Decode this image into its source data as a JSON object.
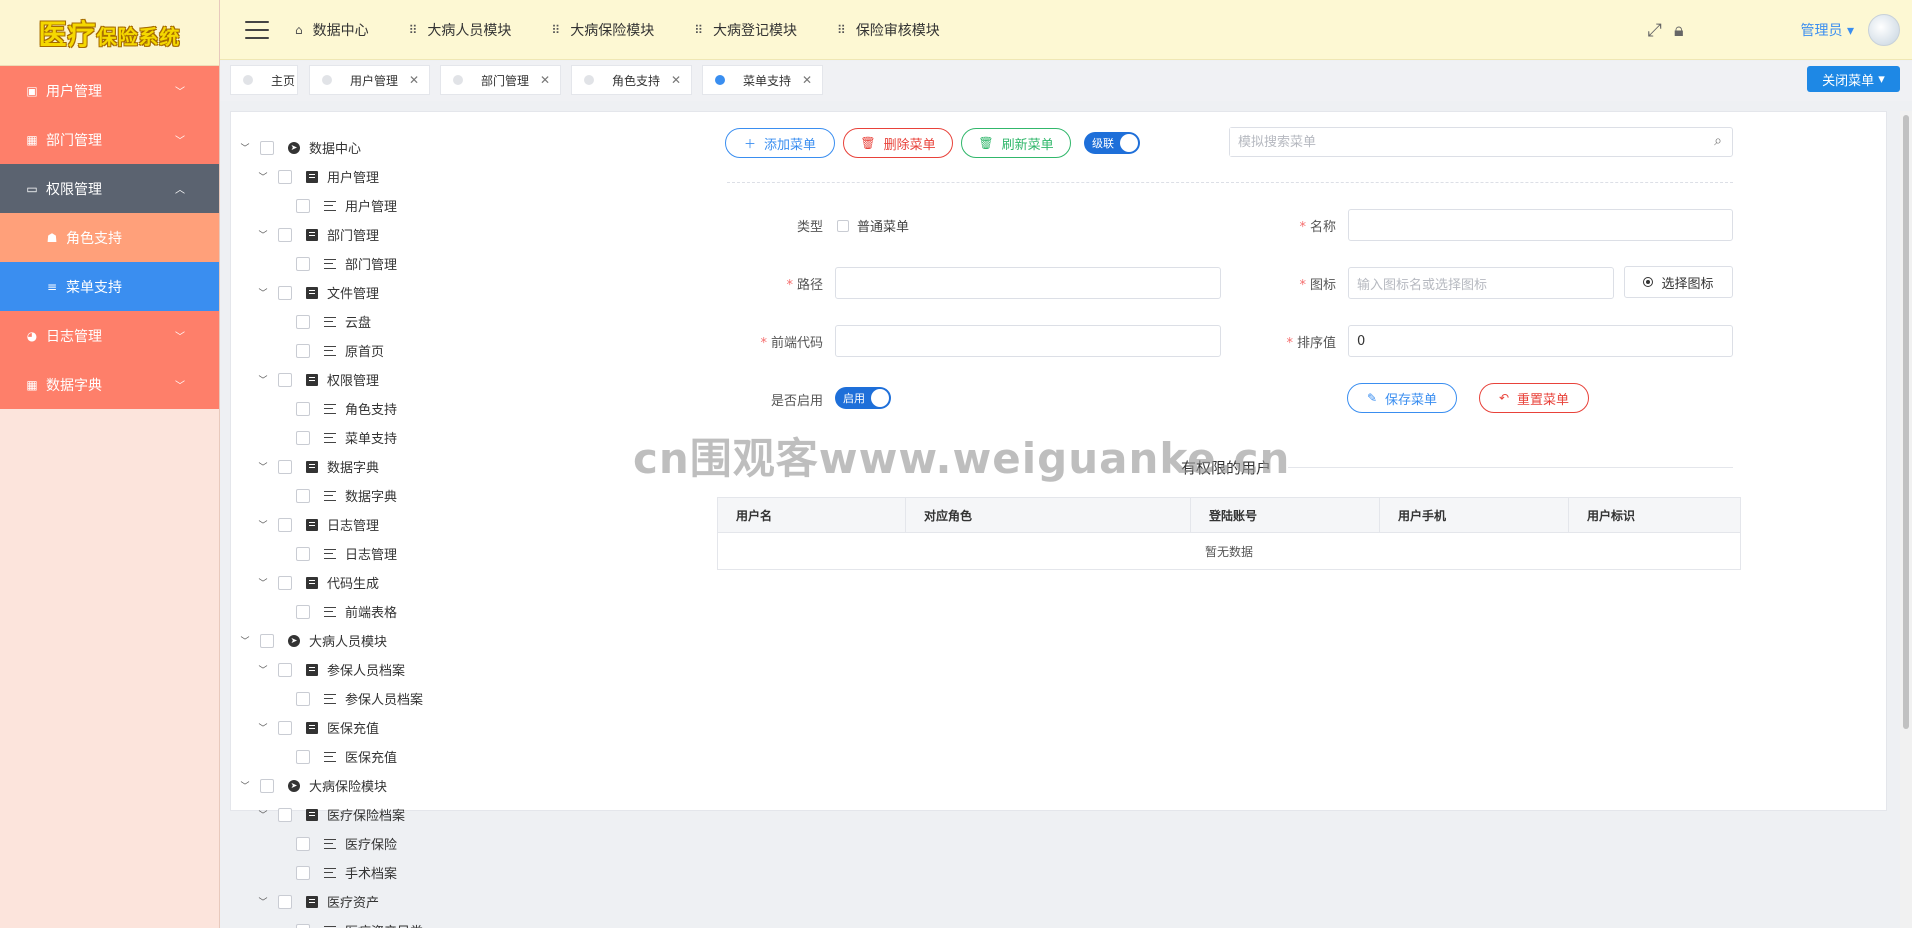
{
  "app": {
    "logo_main": "医疗",
    "logo_sub": "保险系统"
  },
  "sidebar": {
    "items": [
      {
        "label": "用户管理",
        "icon": "dashboard-icon"
      },
      {
        "label": "部门管理",
        "icon": "grid-icon"
      },
      {
        "label": "权限管理",
        "icon": "monitor-icon"
      },
      {
        "label": "角色支持",
        "icon": "users-icon"
      },
      {
        "label": "菜单支持",
        "icon": "list-icon"
      },
      {
        "label": "日志管理",
        "icon": "pie-icon"
      },
      {
        "label": "数据字典",
        "icon": "grid-icon"
      }
    ]
  },
  "header": {
    "nav": [
      {
        "label": "数据中心",
        "icon": "home-icon"
      },
      {
        "label": "大病人员模块",
        "icon": "apps-icon"
      },
      {
        "label": "大病保险模块",
        "icon": "apps-icon"
      },
      {
        "label": "大病登记模块",
        "icon": "apps-icon"
      },
      {
        "label": "保险审核模块",
        "icon": "apps-icon"
      }
    ],
    "user": "管理员"
  },
  "tabs": {
    "items": [
      {
        "label": "主页"
      },
      {
        "label": "用户管理"
      },
      {
        "label": "部门管理"
      },
      {
        "label": "角色支持"
      },
      {
        "label": "菜单支持"
      }
    ],
    "close_menu": "关闭菜单"
  },
  "tree": {
    "nodes": [
      {
        "label": "数据中心",
        "level": 0
      },
      {
        "label": "用户管理",
        "level": 1
      },
      {
        "label": "用户管理",
        "level": 2
      },
      {
        "label": "部门管理",
        "level": 1
      },
      {
        "label": "部门管理",
        "level": 2
      },
      {
        "label": "文件管理",
        "level": 1
      },
      {
        "label": "云盘",
        "level": 2
      },
      {
        "label": "原首页",
        "level": 2
      },
      {
        "label": "权限管理",
        "level": 1
      },
      {
        "label": "角色支持",
        "level": 2
      },
      {
        "label": "菜单支持",
        "level": 2
      },
      {
        "label": "数据字典",
        "level": 1
      },
      {
        "label": "数据字典",
        "level": 2
      },
      {
        "label": "日志管理",
        "level": 1
      },
      {
        "label": "日志管理",
        "level": 2
      },
      {
        "label": "代码生成",
        "level": 1
      },
      {
        "label": "前端表格",
        "level": 2
      },
      {
        "label": "大病人员模块",
        "level": 0
      },
      {
        "label": "参保人员档案",
        "level": 1
      },
      {
        "label": "参保人员档案",
        "level": 2
      },
      {
        "label": "医保充值",
        "level": 1
      },
      {
        "label": "医保充值",
        "level": 2
      },
      {
        "label": "大病保险模块",
        "level": 0
      },
      {
        "label": "医疗保险档案",
        "level": 1
      },
      {
        "label": "医疗保险",
        "level": 2
      },
      {
        "label": "手术档案",
        "level": 2
      },
      {
        "label": "医疗资产",
        "level": 1
      },
      {
        "label": "医疗资产目类",
        "level": 2
      }
    ]
  },
  "toolbar": {
    "add": "添加菜单",
    "delete": "删除菜单",
    "refresh": "刷新菜单",
    "cascade": "级联",
    "search_placeholder": "模拟搜索菜单"
  },
  "form": {
    "type_label": "类型",
    "type_option": "普通菜单",
    "name_label": "名称",
    "name_value": "",
    "path_label": "路径",
    "path_value": "",
    "icon_label": "图标",
    "icon_placeholder": "输入图标名或选择图标",
    "pick_icon": "选择图标",
    "code_label": "前端代码",
    "code_value": "",
    "sort_label": "排序值",
    "sort_value": "0",
    "enabled_label": "是否启用",
    "enabled_switch": "启用",
    "save": "保存菜单",
    "reset": "重置菜单"
  },
  "watermark": "cn围观客www.weiguanke.cn",
  "users_section": {
    "title": "有权限的用户",
    "columns": [
      "用户名",
      "对应角色",
      "登陆账号",
      "用户手机",
      "用户标识"
    ],
    "empty": "暂无数据"
  },
  "colors": {
    "sidebar_item": "#fe7f6a",
    "sidebar_active_parent": "#5b6370",
    "sidebar_sub": "#ffa07a",
    "sidebar_selected": "#3a8ef0",
    "header_bg": "#fdf8d3",
    "primary": "#1e88e5"
  }
}
